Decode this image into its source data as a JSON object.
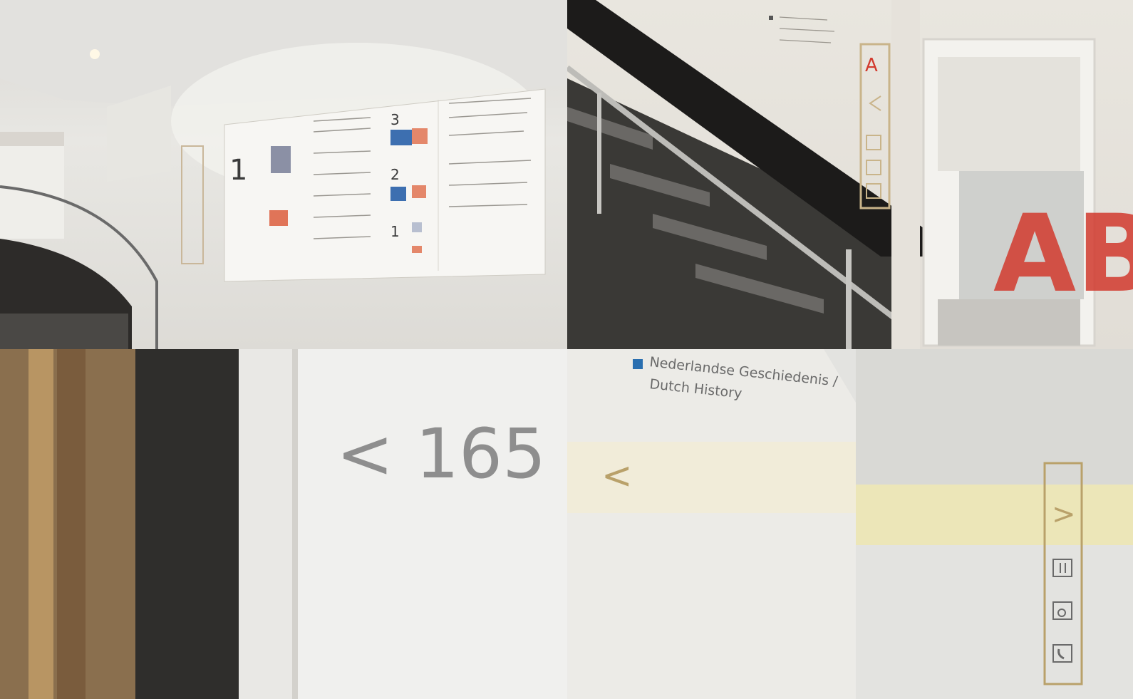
{
  "panels": {
    "p1": {
      "numbers": [
        "1",
        "3",
        "2",
        "1"
      ]
    },
    "p2": {
      "wall_letter": "A",
      "door_letters": "AB"
    },
    "p3": {
      "direction_text": "< 165"
    },
    "p4": {
      "sign_line_1": "Nederlandse Geschiedenis /",
      "sign_line_2": "Dutch History",
      "arrow_left": "<",
      "arrow_right": ">",
      "icons": [
        "restroom-icon",
        "accessible-icon",
        "phone-icon"
      ]
    }
  },
  "colors": {
    "accent_red": "#d23a2e",
    "accent_blue": "#2a6fb0",
    "gold_outline": "#b9a16a",
    "sign_gray": "#8e8e8e"
  }
}
